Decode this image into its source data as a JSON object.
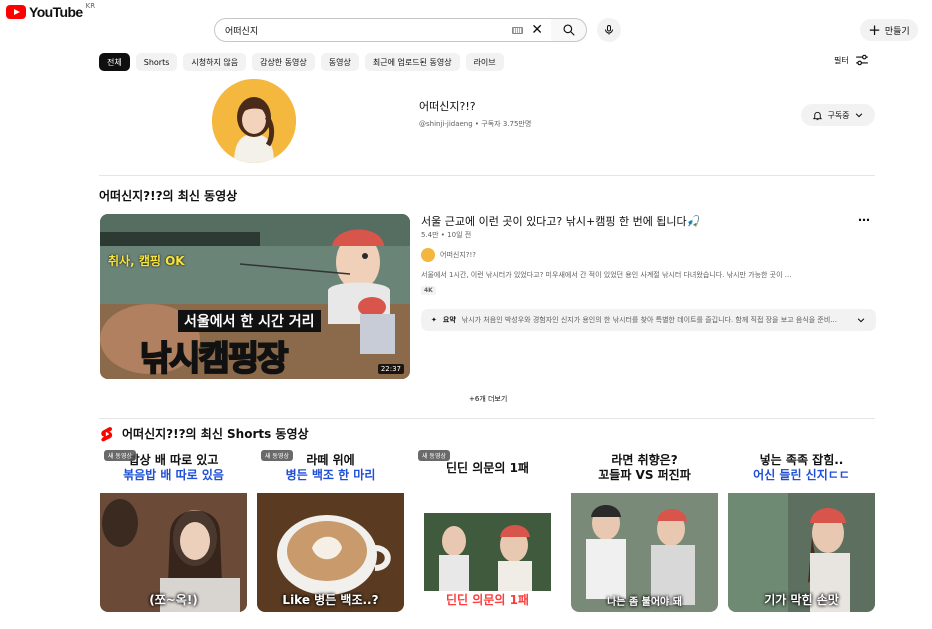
{
  "header": {
    "logo_text": "YouTube",
    "logo_region": "KR",
    "search_value": "어떠신지",
    "create_label": "만들기"
  },
  "chips": [
    "전체",
    "Shorts",
    "시청하지 않음",
    "감상한 동영상",
    "동영상",
    "최근에 업로드된 동영상",
    "라이브"
  ],
  "filter_label": "필터",
  "channel": {
    "name": "어떠신지?!?",
    "handle": "@shinji-jidaeng",
    "subscribers": "구독자 3.75만명",
    "subscribe_label": "구독중"
  },
  "latest": {
    "section_title": "어떠신지?!?의 최신 동영상",
    "video": {
      "title": "서울 근교에 이런 곳이 있다고? 낚시+캠핑 한 번에 됩니다🎣",
      "views": "5.4만",
      "age": "10일 전",
      "channel": "어떠신지?!?",
      "description": "서울에서 1시간, 이런 낚시터가 있었다고? 미우새에서 간 적이 있었던 용인 사계절 낚시터 다녀왔습니다. 낚시만 가능한 곳이 ...",
      "badge": "4K",
      "duration": "22:37",
      "summary_label": "요약",
      "summary_text": "낚시가 처음인 박성우와 경험자인 신지가 용인의 한 낚시터를 찾아 특별한 데이트를 즐깁니다. 함께 직접 장을 보고 음식을 준비...",
      "thumb_text_small": "취사, 캠핑 OK",
      "thumb_text_mid": "서울에서 한 시간 거리",
      "thumb_text_big": "낚시캠핑장"
    },
    "more_label": "+6개 더보기"
  },
  "shorts": {
    "section_title": "어떠신지?!?의 최신 Shorts 동영상",
    "new_badge": "새 동영상",
    "items": [
      {
        "line1": "밥상 배 따로 있고",
        "line2": "볶음밥 배 따로 있음",
        "caption": "(쪼~옥!)",
        "badge": true,
        "bg": "#6b4a38"
      },
      {
        "line1": "라떼 위에",
        "line2": "병든 백조 한 마리",
        "caption": "Like 병든 백조..?",
        "badge": true,
        "bg": "#5a3b22"
      },
      {
        "line1": "딘딘 의문의 1패",
        "line2": "",
        "caption": "딘딘 의문의 1패",
        "badge": true,
        "bg": "#3f5a3c"
      },
      {
        "line1": "라면 취향은?",
        "line2": "꼬들파 VS 퍼진파",
        "caption": "나는 좀 불어야 돼",
        "badge": false,
        "bg": "#7a8a78"
      },
      {
        "line1": "넣는 족족 잡힘..",
        "line2": "어신 들린 신지ㄷㄷ",
        "caption": "기가 막힌 손맛",
        "badge": false,
        "bg": "#5d7060"
      }
    ]
  }
}
